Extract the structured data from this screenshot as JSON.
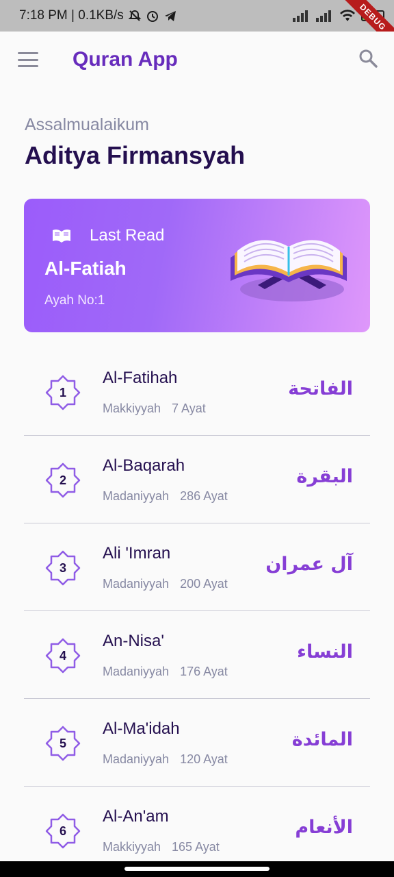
{
  "status_bar": {
    "time": "7:18 PM | 0.1KB/s",
    "battery": "70",
    "debug_label": "DEBUG"
  },
  "app_bar": {
    "title": "Quran App",
    "menu_icon": "hamburger-menu-icon",
    "search_icon": "search-icon"
  },
  "greeting": "Assalmualaikum",
  "user_name": "Aditya Firmansyah",
  "last_read": {
    "label": "Last Read",
    "surah": "Al-Fatiah",
    "ayah": "Ayah No:1"
  },
  "colors": {
    "primary": "#672cbc",
    "text_dark": "#240f4f",
    "text_muted": "#8789a3",
    "arabic": "#863ed5"
  },
  "surahs": [
    {
      "number": "1",
      "name": "Al-Fatihah",
      "type": "Makkiyyah",
      "ayat": "7 Ayat",
      "arabic": "الفاتحة"
    },
    {
      "number": "2",
      "name": "Al-Baqarah",
      "type": "Madaniyyah",
      "ayat": "286 Ayat",
      "arabic": "البقرة"
    },
    {
      "number": "3",
      "name": "Ali 'Imran",
      "type": "Madaniyyah",
      "ayat": "200 Ayat",
      "arabic": "آل عمران"
    },
    {
      "number": "4",
      "name": "An-Nisa'",
      "type": "Madaniyyah",
      "ayat": "176 Ayat",
      "arabic": "النساء"
    },
    {
      "number": "5",
      "name": "Al-Ma'idah",
      "type": "Madaniyyah",
      "ayat": "120 Ayat",
      "arabic": "المائدة"
    },
    {
      "number": "6",
      "name": "Al-An'am",
      "type": "Makkiyyah",
      "ayat": "165 Ayat",
      "arabic": "الأنعام"
    }
  ]
}
